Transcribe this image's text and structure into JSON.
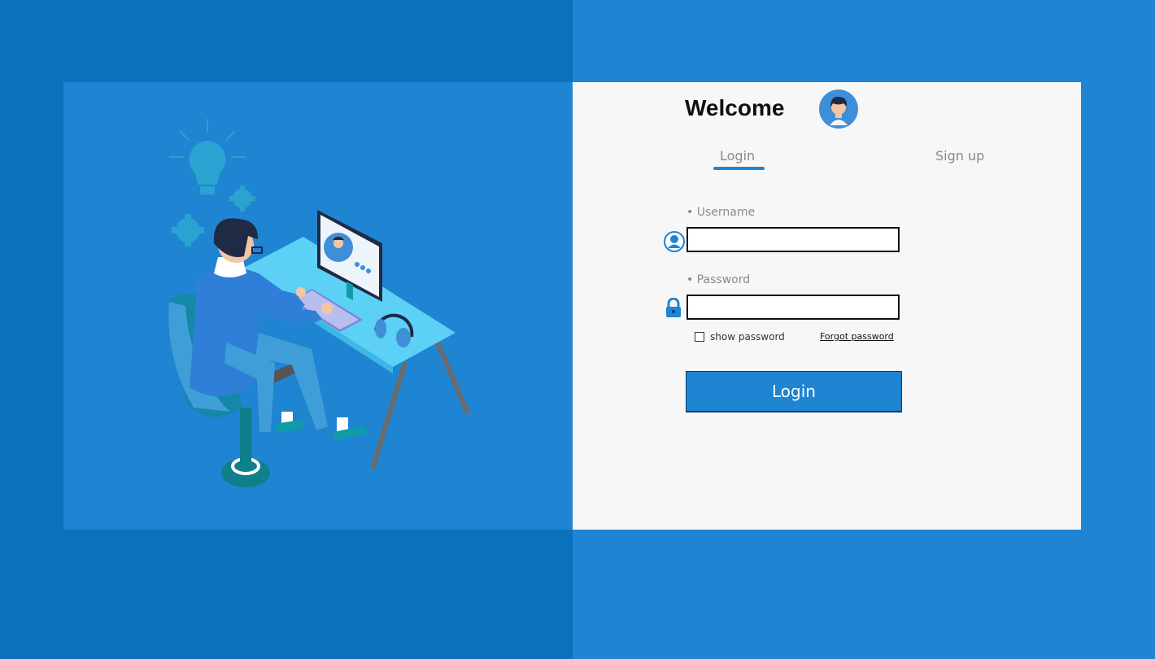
{
  "header": {
    "title": "Welcome"
  },
  "tabs": {
    "login": "Login",
    "signup": "Sign up",
    "active": "login"
  },
  "form": {
    "username_label": "Username",
    "username_value": "",
    "password_label": "Password",
    "password_value": "",
    "show_password_label": "show password",
    "show_password_checked": false,
    "forgot_label": "Forgot password",
    "submit_label": "Login"
  },
  "colors": {
    "accent": "#1f84d1",
    "dark_blue": "#0c71bb",
    "panel": "#f7f7f7"
  },
  "icons": {
    "avatar": "user-avatar-icon",
    "username": "user-icon",
    "password": "lock-icon"
  }
}
